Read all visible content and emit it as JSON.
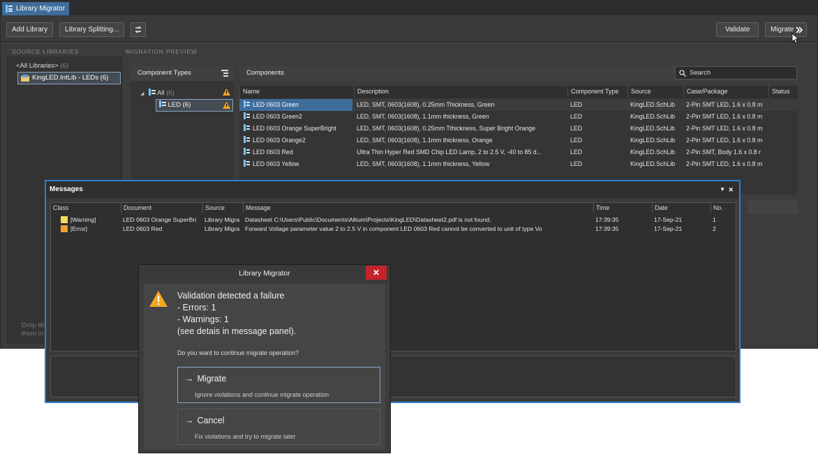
{
  "window": {
    "tab_title": "Library Migrator"
  },
  "toolbar": {
    "add_library": "Add Library",
    "library_splitting": "Library Splitting...",
    "validate": "Validate",
    "migrate": "Migrate"
  },
  "source": {
    "label": "SOURCE LIBRARIES",
    "all_libraries": "<All Libraries>",
    "all_count": "(6)",
    "library_item": "KingLED.IntLib - LEDs (6)",
    "drop_hint_1": "Drop lib",
    "drop_hint_2": "them in"
  },
  "preview": {
    "label": "MIGRATION PREVIEW",
    "types_header": "Component Types",
    "components_header": "Components",
    "search_placeholder": "Search",
    "tree_all": "All",
    "tree_all_count": "(6)",
    "tree_led": "LED (6)"
  },
  "grid": {
    "columns": [
      "Name",
      "Description",
      "Component Type",
      "Source",
      "Case/Package",
      "Status"
    ],
    "rows": [
      [
        "LED 0603 Green",
        "LED, SMT, 0603(1608), 0.25mm Thickness, Green",
        "LED",
        "KingLED.SchLib",
        "2-Pin SMT LED, 1.6 x 0.8 m"
      ],
      [
        "LED 0603 Green2",
        "LED, SMT, 0603(1608), 1.1mm thickness, Green",
        "LED",
        "KingLED.SchLib",
        "2-Pin SMT LED, 1.6 x 0.8 m"
      ],
      [
        "LED 0603 Orange SuperBright",
        "LED, SMT, 0603(1608), 0.25mm Tthickness, Super Bright Orange",
        "LED",
        "KingLED.SchLib",
        "2-Pin SMT LED, 1.6 x 0.8 m"
      ],
      [
        "LED 0603 Orange2",
        "LED, SMT, 0603(1608), 1.1mm thickness, Orange",
        "LED",
        "KingLED.SchLib",
        "2-Pin SMT LED, 1.6 x 0.8 m"
      ],
      [
        "LED 0603 Red",
        "Ultra Thin Hyper Red SMD Chip LED Lamp, 2 to 2.5 V, -40 to 85 d...",
        "LED",
        "KingLED.SchLib",
        "2-Pin SMT, Body 1.6 x 0.8 r"
      ],
      [
        "LED 0603 Yellow",
        "LED, SMT, 0603(1608), 1.1mm thickness, Yellow",
        "LED",
        "KingLED.SchLib",
        "2-Pin SMT LED, 1.6 x 0.8 m"
      ]
    ]
  },
  "messages": {
    "title": "Messages",
    "columns": [
      "Class",
      "Document",
      "Source",
      "Message",
      "Time",
      "Date",
      "No."
    ],
    "rows": [
      {
        "class": "[Warning]",
        "document": "LED 0603 Orange SuperBri",
        "source": "Library Migra",
        "message": "Datasheet C:\\Users\\Public\\Documents\\Altium\\Projects\\KingLED\\Datasheet2.pdf is not found.",
        "time": "17:39:35",
        "date": "17-Sep-21",
        "no": "1",
        "color": "#f5d95a"
      },
      {
        "class": "[Error]",
        "document": "LED 0603 Red",
        "source": "Library Migra",
        "message": "Forward Voltage parameter value 2 to 2.5 V in component LED 0603 Red cannot be converted to unit of type Vo",
        "time": "17:39:35",
        "date": "17-Sep-21",
        "no": "2",
        "color": "#f0a030"
      }
    ]
  },
  "dialog": {
    "title": "Library Migrator",
    "close": "✕",
    "heading": "Validation detected a failure",
    "errors": " - Errors: 1",
    "warnings": " - Warnings: 1",
    "see_details": "(see detais in message panel).",
    "question": "Do you want to continue migrate operation?",
    "migrate_title": "Migrate",
    "migrate_sub": "Ignore violations and continue migrate operation",
    "cancel_title": "Cancel",
    "cancel_sub": "Fix violations and try to migrate later"
  },
  "colors": {
    "accent": "#2d7fd6",
    "selection": "#3f6d9a",
    "close": "#c7232b",
    "warning": "#f5a623"
  }
}
